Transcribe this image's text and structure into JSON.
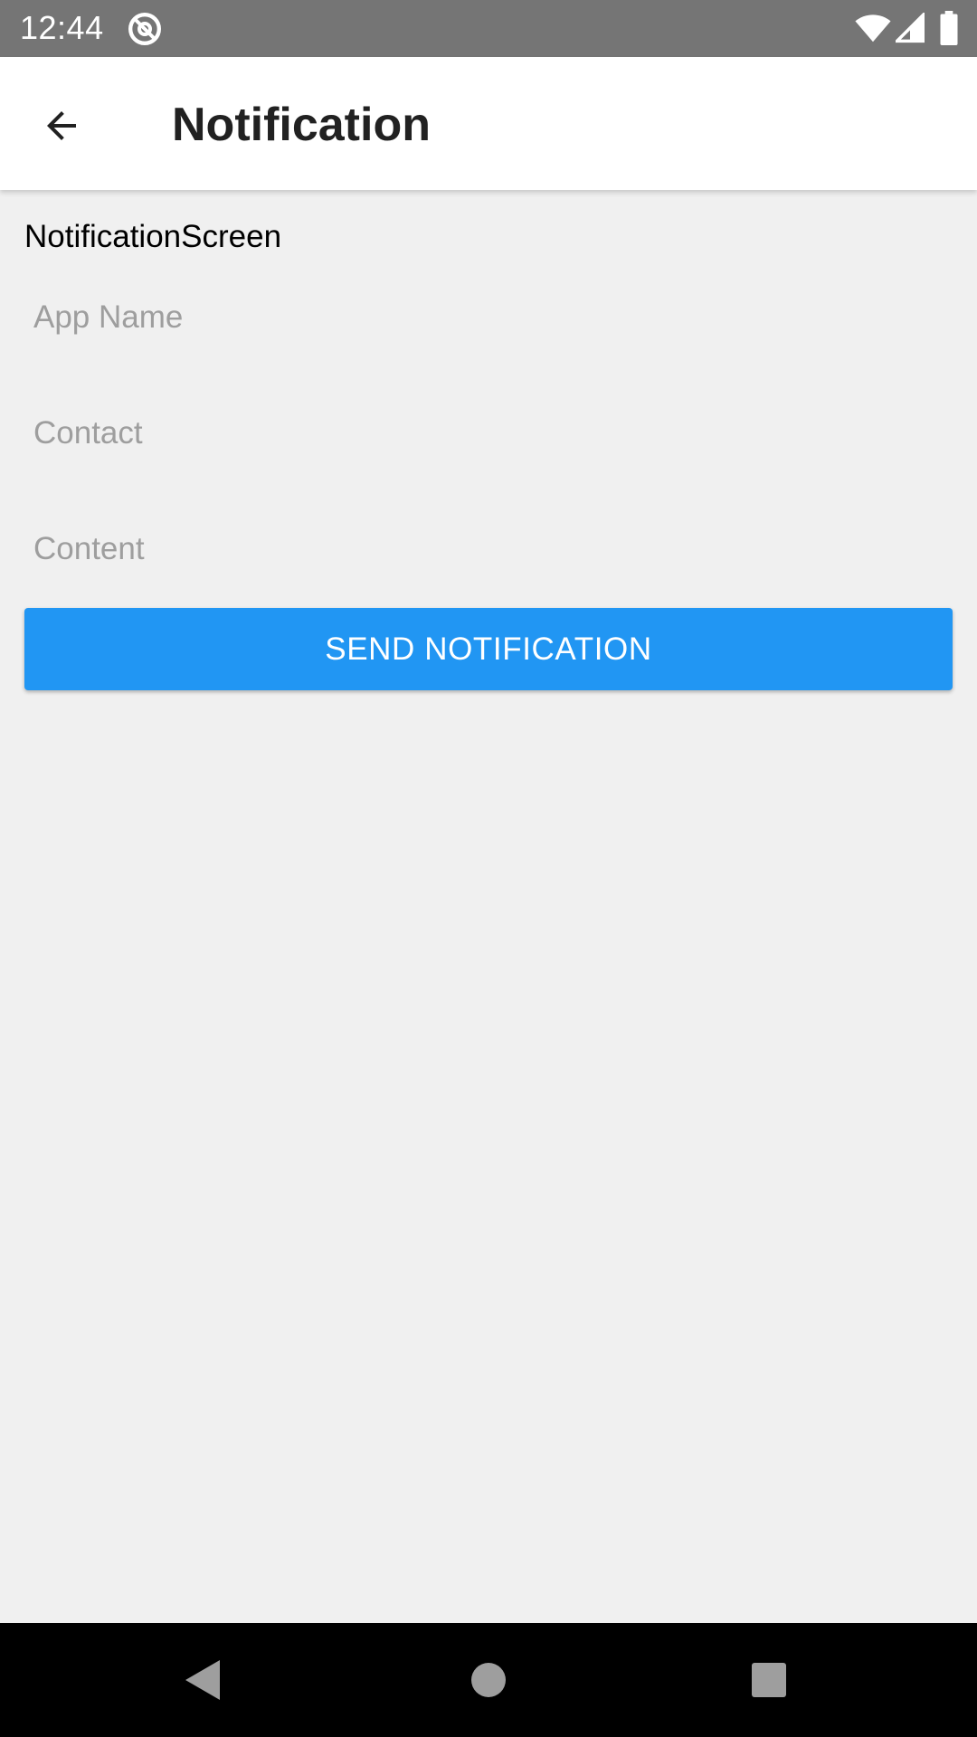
{
  "status_bar": {
    "time": "12:44",
    "icons": [
      "at-sign-icon",
      "wifi-icon",
      "cell-signal-icon",
      "battery-icon"
    ]
  },
  "app_bar": {
    "title": "Notification",
    "back_icon": "arrow-back-icon"
  },
  "main": {
    "screen_label": "NotificationScreen",
    "fields": {
      "app_name": {
        "value": "",
        "placeholder": "App Name"
      },
      "contact": {
        "value": "",
        "placeholder": "Contact"
      },
      "content": {
        "value": "",
        "placeholder": "Content"
      }
    },
    "send_button_label": "SEND NOTIFICATION"
  },
  "nav_bar": {
    "icons": [
      "nav-back-icon",
      "nav-home-icon",
      "nav-recents-icon"
    ]
  },
  "colors": {
    "status_bar": "#757575",
    "app_bar": "#ffffff",
    "background": "#f0f0f0",
    "accent": "#2196f3",
    "nav_bar": "#000000"
  }
}
